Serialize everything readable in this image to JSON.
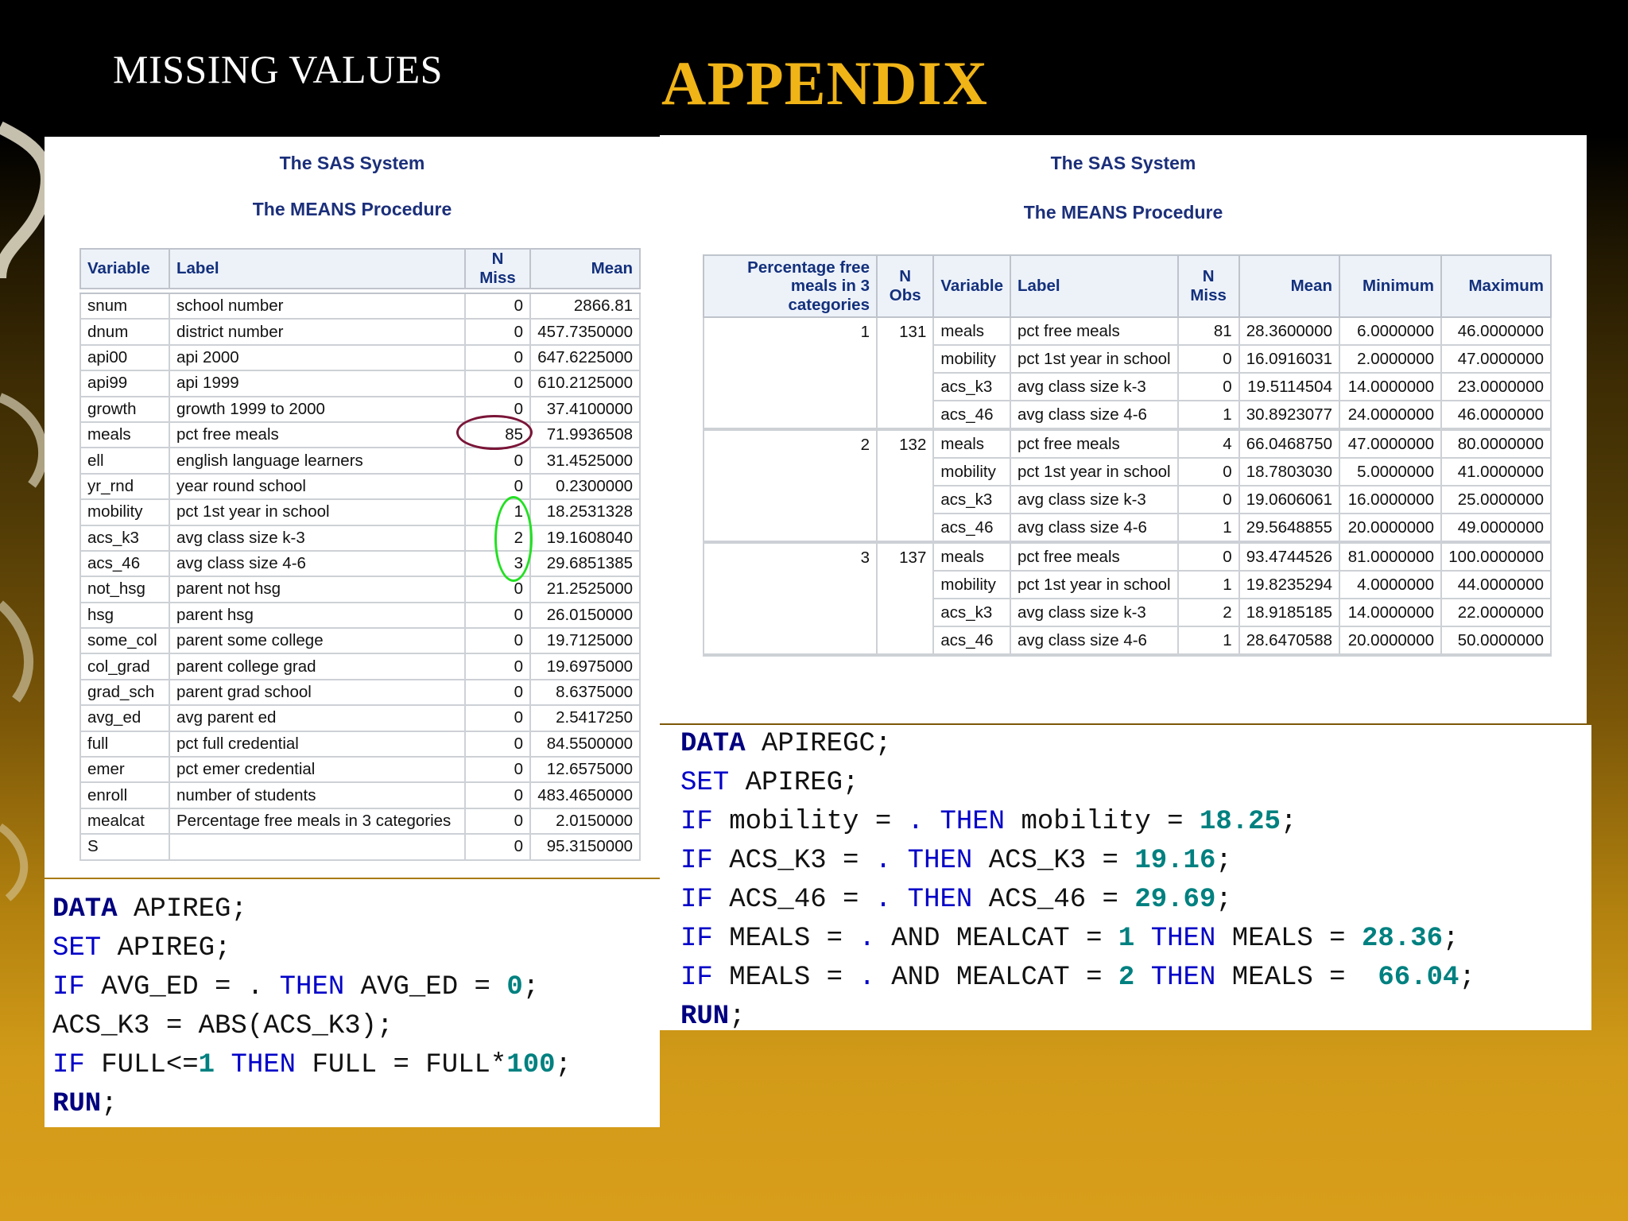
{
  "slide": {
    "heading": "MISSING VALUES",
    "title": "APPENDIX"
  },
  "left_output": {
    "sas_title": "The SAS System",
    "procedure": "The MEANS Procedure",
    "headers": [
      "Variable",
      "Label",
      "N Miss",
      "Mean"
    ],
    "rows": [
      [
        "snum",
        "school number",
        "0",
        "2866.81"
      ],
      [
        "dnum",
        "district number",
        "0",
        "457.7350000"
      ],
      [
        "api00",
        "api 2000",
        "0",
        "647.6225000"
      ],
      [
        "api99",
        "api 1999",
        "0",
        "610.2125000"
      ],
      [
        "growth",
        "growth 1999 to 2000",
        "0",
        "37.4100000"
      ],
      [
        "meals",
        "pct free meals",
        "85",
        "71.9936508"
      ],
      [
        "ell",
        "english language learners",
        "0",
        "31.4525000"
      ],
      [
        "yr_rnd",
        "year round school",
        "0",
        "0.2300000"
      ],
      [
        "mobility",
        "pct 1st year in school",
        "1",
        "18.2531328"
      ],
      [
        "acs_k3",
        "avg class size k-3",
        "2",
        "19.1608040"
      ],
      [
        "acs_46",
        "avg class size 4-6",
        "3",
        "29.6851385"
      ],
      [
        "not_hsg",
        "parent not hsg",
        "0",
        "21.2525000"
      ],
      [
        "hsg",
        "parent hsg",
        "0",
        "26.0150000"
      ],
      [
        "some_col",
        "parent some college",
        "0",
        "19.7125000"
      ],
      [
        "col_grad",
        "parent college grad",
        "0",
        "19.6975000"
      ],
      [
        "grad_sch",
        "parent grad school",
        "0",
        "8.6375000"
      ],
      [
        "avg_ed",
        "avg parent ed",
        "0",
        "2.5417250"
      ],
      [
        "full",
        "pct full credential",
        "0",
        "84.5500000"
      ],
      [
        "emer",
        "pct emer credential",
        "0",
        "12.6575000"
      ],
      [
        "enroll",
        "number of students",
        "0",
        "483.4650000"
      ],
      [
        "mealcat",
        "Percentage free meals in 3 categories",
        "0",
        "2.0150000"
      ],
      [
        "S",
        "",
        "0",
        "95.3150000"
      ]
    ]
  },
  "right_output": {
    "sas_title": "The SAS System",
    "procedure": "The MEANS Procedure",
    "headers": [
      "Percentage free meals in 3 categories",
      "N Obs",
      "Variable",
      "Label",
      "N Miss",
      "Mean",
      "Minimum",
      "Maximum"
    ],
    "groups": [
      {
        "category": "1",
        "n_obs": "131",
        "rows": [
          [
            "meals",
            "pct free meals",
            "81",
            "28.3600000",
            "6.0000000",
            "46.0000000"
          ],
          [
            "mobility",
            "pct 1st year in school",
            "0",
            "16.0916031",
            "2.0000000",
            "47.0000000"
          ],
          [
            "acs_k3",
            "avg class size k-3",
            "0",
            "19.5114504",
            "14.0000000",
            "23.0000000"
          ],
          [
            "acs_46",
            "avg class size 4-6",
            "1",
            "30.8923077",
            "24.0000000",
            "46.0000000"
          ]
        ]
      },
      {
        "category": "2",
        "n_obs": "132",
        "rows": [
          [
            "meals",
            "pct free meals",
            "4",
            "66.0468750",
            "47.0000000",
            "80.0000000"
          ],
          [
            "mobility",
            "pct 1st year in school",
            "0",
            "18.7803030",
            "5.0000000",
            "41.0000000"
          ],
          [
            "acs_k3",
            "avg class size k-3",
            "0",
            "19.0606061",
            "16.0000000",
            "25.0000000"
          ],
          [
            "acs_46",
            "avg class size 4-6",
            "1",
            "29.5648855",
            "20.0000000",
            "49.0000000"
          ]
        ]
      },
      {
        "category": "3",
        "n_obs": "137",
        "rows": [
          [
            "meals",
            "pct free meals",
            "0",
            "93.4744526",
            "81.0000000",
            "100.0000000"
          ],
          [
            "mobility",
            "pct 1st year in school",
            "1",
            "19.8235294",
            "4.0000000",
            "44.0000000"
          ],
          [
            "acs_k3",
            "avg class size k-3",
            "2",
            "18.9185185",
            "14.0000000",
            "22.0000000"
          ],
          [
            "acs_46",
            "avg class size 4-6",
            "1",
            "28.6470588",
            "20.0000000",
            "50.0000000"
          ]
        ]
      }
    ]
  },
  "code_left": {
    "lines": [
      [
        [
          "kwb",
          "DATA"
        ],
        [
          "t",
          " APIREG;"
        ]
      ],
      [
        [
          "kw",
          "SET"
        ],
        [
          "t",
          " APIREG;"
        ]
      ],
      [
        [
          "kw",
          "IF"
        ],
        [
          "t",
          " AVG_ED = . "
        ],
        [
          "kw",
          "THEN"
        ],
        [
          "t",
          " AVG_ED = "
        ],
        [
          "n",
          "0"
        ],
        [
          "t",
          ";"
        ]
      ],
      [
        [
          "t",
          "ACS_K3 = ABS(ACS_K3);"
        ]
      ],
      [
        [
          "kw",
          "IF"
        ],
        [
          "t",
          " FULL<="
        ],
        [
          "n",
          "1"
        ],
        [
          "t",
          " "
        ],
        [
          "kw",
          "THEN"
        ],
        [
          "t",
          " FULL = FULL*"
        ],
        [
          "n",
          "100"
        ],
        [
          "t",
          ";"
        ]
      ],
      [
        [
          "kwb",
          "RUN"
        ],
        [
          "t",
          ";"
        ]
      ]
    ]
  },
  "code_right": {
    "lines": [
      [
        [
          "kwb",
          "DATA"
        ],
        [
          "t",
          " APIREGC;"
        ]
      ],
      [
        [
          "kw",
          "SET"
        ],
        [
          "t",
          " APIREG;"
        ]
      ],
      [
        [
          "kw",
          "IF"
        ],
        [
          "t",
          " mobility = "
        ],
        [
          "kw",
          "."
        ],
        [
          "t",
          " "
        ],
        [
          "kw",
          "THEN"
        ],
        [
          "t",
          " mobility = "
        ],
        [
          "n",
          "18.25"
        ],
        [
          "t",
          ";"
        ]
      ],
      [
        [
          "kw",
          "IF"
        ],
        [
          "t",
          " ACS_K3 = "
        ],
        [
          "kw",
          "."
        ],
        [
          "t",
          " "
        ],
        [
          "kw",
          "THEN"
        ],
        [
          "t",
          " ACS_K3 = "
        ],
        [
          "n",
          "19.16"
        ],
        [
          "t",
          ";"
        ]
      ],
      [
        [
          "kw",
          "IF"
        ],
        [
          "t",
          " ACS_46 = "
        ],
        [
          "kw",
          "."
        ],
        [
          "t",
          " "
        ],
        [
          "kw",
          "THEN"
        ],
        [
          "t",
          " ACS_46 = "
        ],
        [
          "n",
          "29.69"
        ],
        [
          "t",
          ";"
        ]
      ],
      [
        [
          "kw",
          "IF"
        ],
        [
          "t",
          " MEALS = "
        ],
        [
          "kw",
          "."
        ],
        [
          "t",
          " AND MEALCAT = "
        ],
        [
          "n",
          "1"
        ],
        [
          "t",
          " "
        ],
        [
          "kw",
          "THEN"
        ],
        [
          "t",
          " MEALS = "
        ],
        [
          "n",
          "28.36"
        ],
        [
          "t",
          ";"
        ]
      ],
      [
        [
          "kw",
          "IF"
        ],
        [
          "t",
          " MEALS = "
        ],
        [
          "kw",
          "."
        ],
        [
          "t",
          " AND MEALCAT = "
        ],
        [
          "n",
          "2"
        ],
        [
          "t",
          " "
        ],
        [
          "kw",
          "THEN"
        ],
        [
          "t",
          " MEALS =  "
        ],
        [
          "n",
          "66.04"
        ],
        [
          "t",
          ";"
        ]
      ],
      [
        [
          "kwb",
          "RUN"
        ],
        [
          "t",
          ";"
        ]
      ]
    ]
  }
}
